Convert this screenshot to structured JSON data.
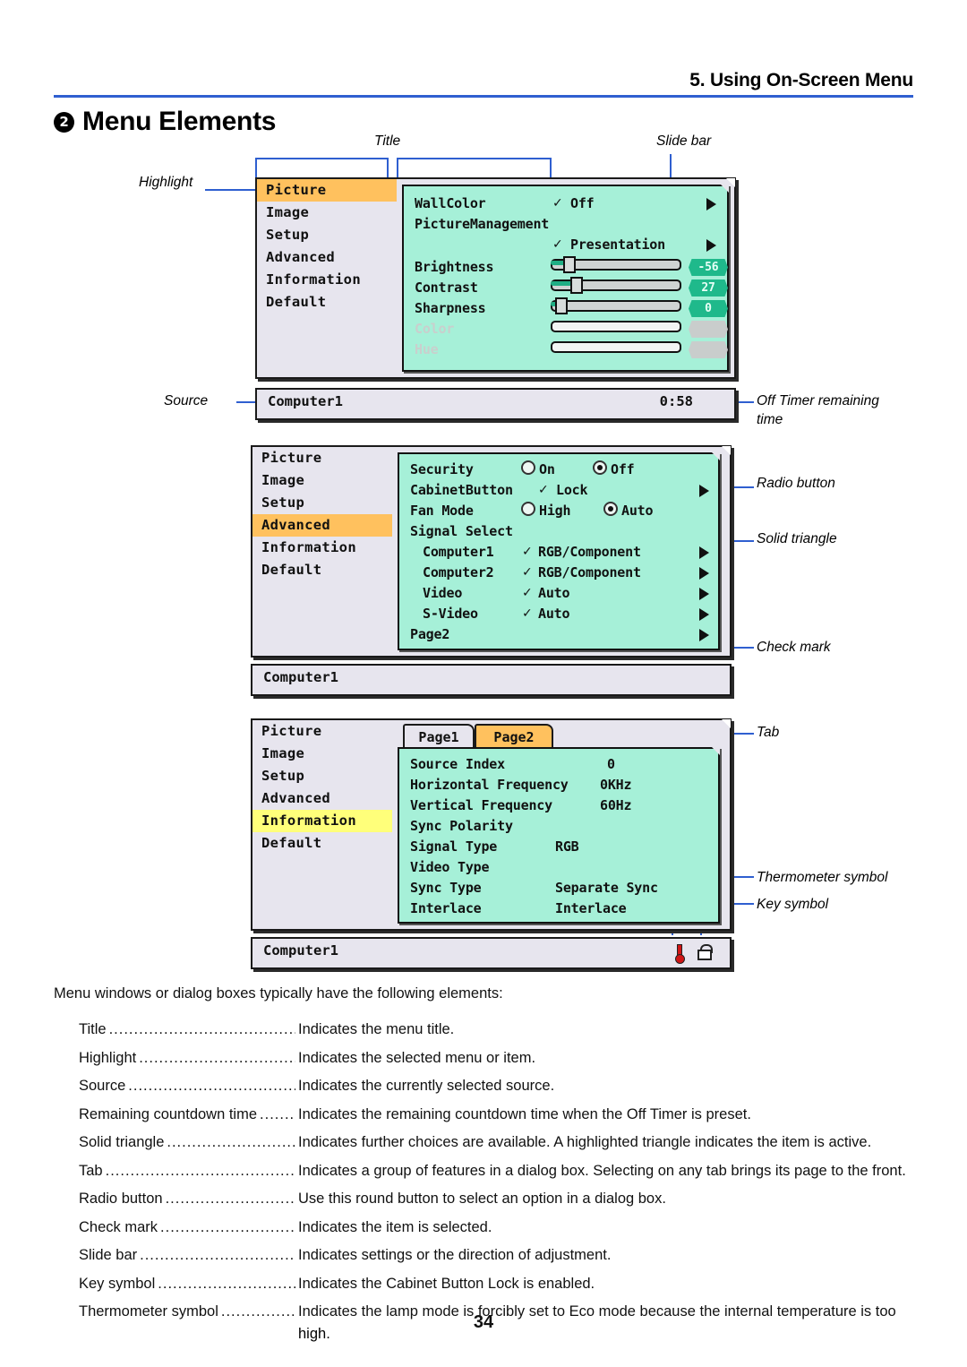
{
  "header": {
    "chapter": "5. Using On-Screen Menu",
    "section_number": "2",
    "section_title": "Menu Elements"
  },
  "callouts": {
    "title": "Title",
    "slide_bar": "Slide bar",
    "highlight": "Highlight",
    "source": "Source",
    "off_timer": "Off Timer remaining\ntime",
    "radio_button": "Radio button",
    "solid_triangle": "Solid triangle",
    "check_mark": "Check mark",
    "tab": "Tab",
    "thermometer_symbol": "Thermometer symbol",
    "key_symbol": "Key symbol"
  },
  "colors": {
    "accent_blue": "#2f5fd0",
    "highlight_orange": "#ffc15e",
    "highlight_yellow": "#ffff7a",
    "osd_body_green": "#a6f0d8",
    "osd_shell_gray": "#e7e5ee",
    "badge_green": "#1fb98b",
    "badge_disabled": "#c9cdcc",
    "thermometer_red": "#d01515"
  },
  "sidebar_items": [
    "Picture",
    "Image",
    "Setup",
    "Advanced",
    "Information",
    "Default"
  ],
  "panel1": {
    "highlighted": "Picture",
    "rows": [
      {
        "label": "WallColor",
        "check": "✓",
        "value": "Off",
        "arrow": true
      },
      {
        "label": "PictureManagement",
        "check": "",
        "value": "",
        "arrow": false
      },
      {
        "label": "",
        "check": "✓",
        "value": "Presentation",
        "arrow": true
      },
      {
        "label": "Brightness",
        "slider": true,
        "badge": "-56"
      },
      {
        "label": "Contrast",
        "slider": true,
        "badge": "27"
      },
      {
        "label": "Sharpness",
        "slider": true,
        "badge": "0"
      },
      {
        "label": "Color",
        "slider": true,
        "badge": "",
        "disabled": true
      },
      {
        "label": "Hue",
        "slider": true,
        "badge": "",
        "disabled": true
      }
    ],
    "sliders": {
      "brightness_pct": 12,
      "contrast_pct": 22,
      "sharpness_pct": 5
    },
    "status": {
      "source": "Computer1",
      "timer": "0:58"
    }
  },
  "panel2": {
    "highlighted": "Advanced",
    "rows": [
      {
        "label": "Security",
        "type": "radio",
        "options": [
          {
            "text": "On",
            "selected": false
          },
          {
            "text": "Off",
            "selected": true
          }
        ]
      },
      {
        "label": "CabinetButton",
        "type": "check",
        "check": "✓",
        "value": "Lock",
        "arrow": true
      },
      {
        "label": "Fan Mode",
        "type": "radio",
        "options": [
          {
            "text": "High",
            "selected": false
          },
          {
            "text": "Auto",
            "selected": true
          }
        ]
      },
      {
        "label": "Signal Select",
        "type": "plain"
      },
      {
        "label": "Computer1",
        "type": "check",
        "check": "✓",
        "value": "RGB/Component",
        "arrow": true,
        "indent": true
      },
      {
        "label": "Computer2",
        "type": "check",
        "check": "✓",
        "value": "RGB/Component",
        "arrow": true,
        "indent": true
      },
      {
        "label": "Video",
        "type": "check",
        "check": "✓",
        "value": "Auto",
        "arrow": true,
        "indent": true
      },
      {
        "label": "S-Video",
        "type": "check",
        "check": "✓",
        "value": "Auto",
        "arrow": true,
        "indent": true
      },
      {
        "label": "Page2",
        "type": "plain",
        "arrow": true
      }
    ],
    "status": {
      "source": "Computer1",
      "timer": ""
    }
  },
  "panel3": {
    "highlighted": "Information",
    "tabs": [
      {
        "label": "Page1",
        "active": false
      },
      {
        "label": "Page2",
        "active": true
      }
    ],
    "rows": [
      {
        "label": "Source Index",
        "value": "0"
      },
      {
        "label": "Horizontal Frequency",
        "value": "0KHz"
      },
      {
        "label": "Vertical Frequency",
        "value": "60Hz"
      },
      {
        "label": "Sync Polarity",
        "value": ""
      },
      {
        "label": "Signal Type",
        "value": "RGB"
      },
      {
        "label": "Video Type",
        "value": ""
      },
      {
        "label": "Sync Type",
        "value": "Separate Sync"
      },
      {
        "label": "Interlace",
        "value": "Interlace"
      }
    ],
    "status": {
      "source": "Computer1",
      "icons": [
        "thermometer-icon",
        "key-icon"
      ]
    }
  },
  "body": {
    "intro": "Menu windows or dialog boxes typically have the following elements:",
    "definitions": [
      {
        "term": "Title",
        "desc": "Indicates the menu title."
      },
      {
        "term": "Highlight",
        "desc": "Indicates the selected menu or item."
      },
      {
        "term": "Source",
        "desc": "Indicates the currently selected source."
      },
      {
        "term": "Remaining countdown time",
        "desc": "Indicates the remaining countdown time when the Off Timer is preset."
      },
      {
        "term": "Solid triangle",
        "desc": "Indicates further choices are available. A highlighted triangle indicates the item is active."
      },
      {
        "term": "Tab",
        "desc": "Indicates a group of features in a dialog box. Selecting on any tab brings its page to the front."
      },
      {
        "term": "Radio button",
        "desc": "Use this round button to select an option in a dialog box."
      },
      {
        "term": "Check mark",
        "desc": "Indicates the item is selected."
      },
      {
        "term": "Slide bar",
        "desc": "Indicates settings or the direction of adjustment."
      },
      {
        "term": "Key symbol",
        "desc": "Indicates the Cabinet Button Lock is enabled."
      },
      {
        "term": "Thermometer symbol",
        "desc": "Indicates the lamp mode is forcibly set to Eco mode because the internal temperature is too",
        "cont": "high."
      }
    ],
    "page_number": "34"
  }
}
